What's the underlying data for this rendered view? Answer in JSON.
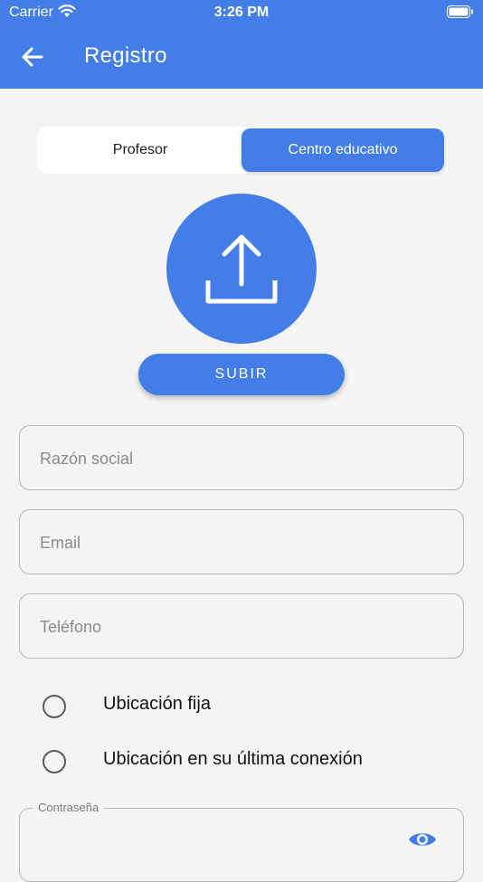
{
  "status_bar": {
    "carrier": "Carrier",
    "time": "3:26 PM"
  },
  "app_bar": {
    "title": "Registro"
  },
  "segment": {
    "left_label": "Profesor",
    "right_label": "Centro educativo",
    "selected": "Centro educativo"
  },
  "upload": {
    "button_label": "SUBIR"
  },
  "fields": {
    "razon_social_placeholder": "Razón social",
    "email_placeholder": "Email",
    "telefono_placeholder": "Teléfono"
  },
  "location_options": [
    {
      "label": "Ubicación fija"
    },
    {
      "label": "Ubicación en su última conexión"
    }
  ],
  "password": {
    "label": "Contraseña"
  },
  "colors": {
    "primary": "#437ee8",
    "background": "#f4f4f4"
  }
}
